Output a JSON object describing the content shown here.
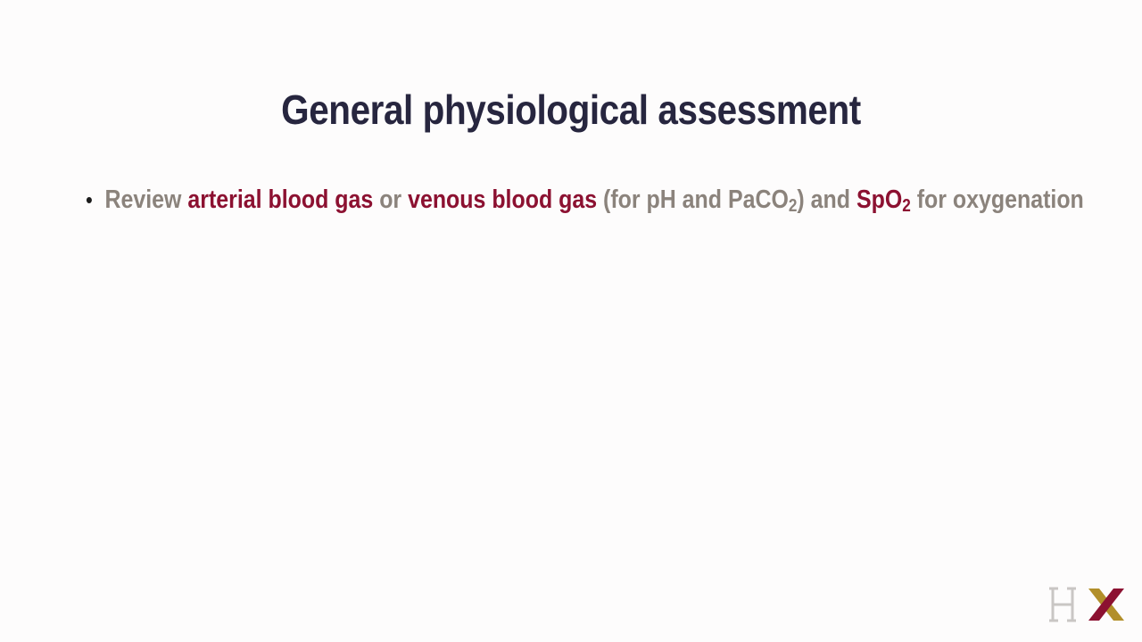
{
  "slide": {
    "title": "General physiological assessment",
    "bullets": [
      {
        "seg1": "Review ",
        "seg2": "arterial blood gas",
        "seg3": " or ",
        "seg4": "venous blood gas",
        "seg5": " (for pH and PaCO",
        "seg5_sub": "2",
        "seg6": ") and ",
        "seg7": "SpO",
        "seg7_sub": "2",
        "seg8": " for oxygenation"
      }
    ],
    "logo": {
      "text": "HX",
      "colors": {
        "h": "#c9c6c4",
        "x_gold": "#b28f2a",
        "x_red": "#8c1131"
      }
    }
  },
  "colors": {
    "title": "#27263f",
    "body": "#8b837c",
    "highlight": "#8c1131",
    "background": "#fdfcfc"
  }
}
